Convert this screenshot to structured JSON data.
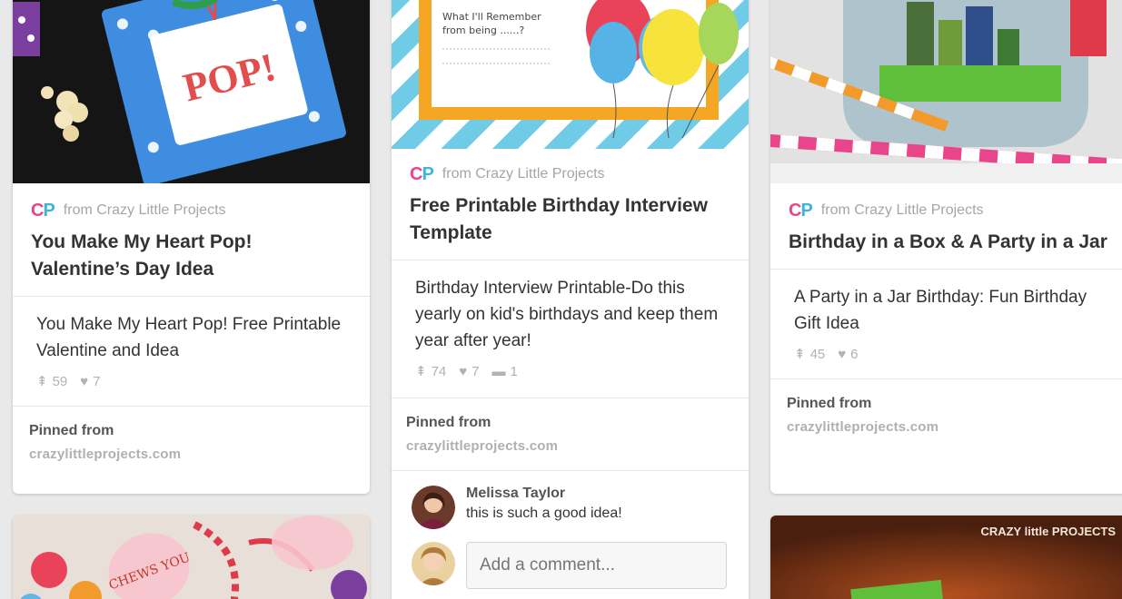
{
  "pins": [
    {
      "source_prefix": "from",
      "source_name": "Crazy Little Projects",
      "logo_letters": [
        "C",
        "P"
      ],
      "title": "You Make My Heart Pop! Valentine’s Day Idea",
      "description": "You Make My Heart Pop! Free Printable Valentine and Idea",
      "repins": "59",
      "likes": "7",
      "pinned_label": "Pinned from",
      "pinned_domain": "crazylittleprojects.com",
      "image_text": "POP!"
    },
    {
      "source_prefix": "from",
      "source_name": "Crazy Little Projects",
      "logo_letters": [
        "C",
        "P"
      ],
      "title": "Free Printable Birthday Interview Template",
      "description": "Birthday Interview Printable-Do this yearly on kid's birthdays and keep them year after year!",
      "repins": "74",
      "likes": "7",
      "comments": "1",
      "pinned_label": "Pinned from",
      "pinned_domain": "crazylittleprojects.com",
      "image_text": "What I'll Remember from being ......?",
      "comment": {
        "author": "Melissa Taylor",
        "text": "this is such a good idea!"
      },
      "comment_placeholder": "Add a comment..."
    },
    {
      "source_prefix": "from",
      "source_name": "Crazy Little Projects",
      "logo_letters": [
        "C",
        "P"
      ],
      "title": "Birthday in a Box & A Party in a Jar",
      "description": "A Party in a Jar Birthday: Fun Birthday Gift Idea",
      "repins": "45",
      "likes": "6",
      "pinned_label": "Pinned from",
      "pinned_domain": "crazylittleprojects.com"
    }
  ],
  "bottom_pins": [
    {
      "image_text": "CHEWS YOU"
    },
    {
      "image_text": "CRAZY little PROJECTS"
    }
  ],
  "colors": {
    "background": "#e9e9e9",
    "logo_c": "#e8458b",
    "logo_p": "#3bb6d8",
    "title_text": "#333333",
    "muted": "#a6a6a6"
  }
}
